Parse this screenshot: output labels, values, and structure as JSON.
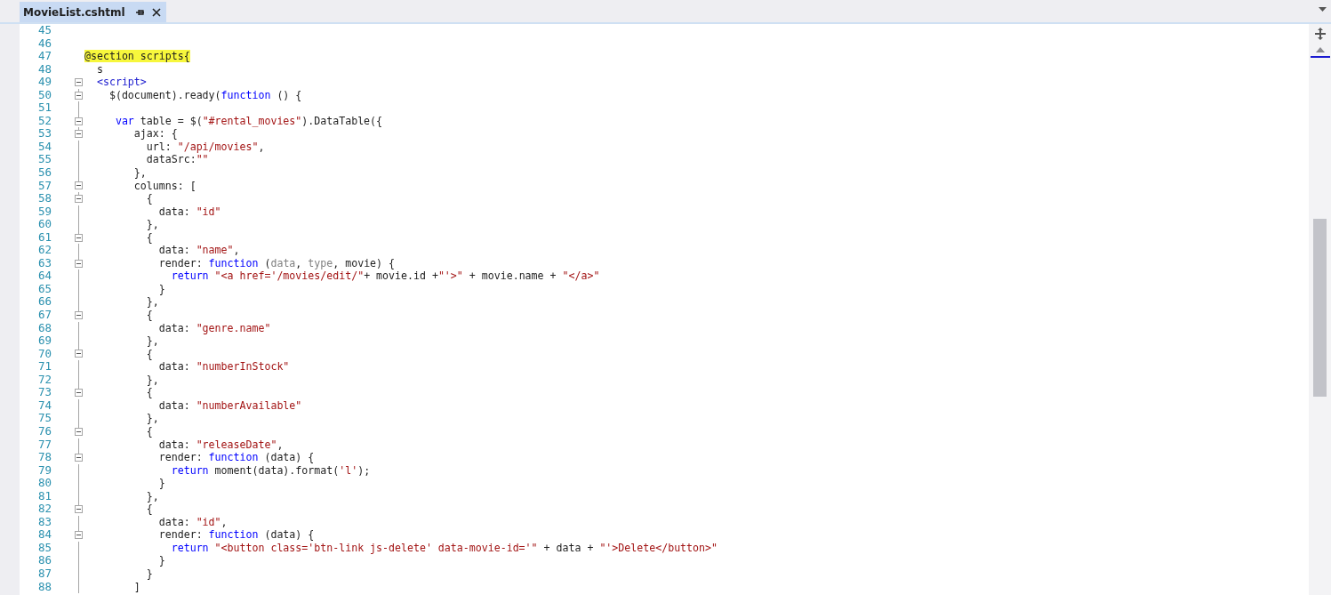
{
  "tab": {
    "title": "MovieList.cshtml",
    "selected": true
  },
  "editor": {
    "lines": [
      {
        "number": "45"
      },
      {
        "number": "46"
      },
      {
        "number": "47",
        "tokens": [
          {
            "kind": "highlight",
            "text": "@section scripts{"
          }
        ]
      },
      {
        "number": "48",
        "tokens": [
          {
            "kind": "plain",
            "text": "  s"
          }
        ]
      },
      {
        "number": "49",
        "expanded": true,
        "tokens": [
          {
            "kind": "tag",
            "text": "  <script>"
          }
        ]
      },
      {
        "number": "50",
        "expanded": true,
        "tokens": [
          {
            "kind": "plain",
            "text": "    $(document).ready("
          },
          {
            "kind": "keyword",
            "text": "function"
          },
          {
            "kind": "plain",
            "text": " () {"
          }
        ]
      },
      {
        "number": "51"
      },
      {
        "number": "52",
        "expanded": true,
        "tokens": [
          {
            "kind": "keyword",
            "text": "     var"
          },
          {
            "kind": "plain",
            "text": " table = $("
          },
          {
            "kind": "string",
            "text": "\"#rental_movies\""
          },
          {
            "kind": "plain",
            "text": ").DataTable({"
          }
        ]
      },
      {
        "number": "53",
        "expanded": true,
        "tokens": [
          {
            "kind": "plain",
            "text": "        ajax: {"
          }
        ]
      },
      {
        "number": "54",
        "tokens": [
          {
            "kind": "plain",
            "text": "          url: "
          },
          {
            "kind": "string",
            "text": "\"/api/movies\""
          },
          {
            "kind": "plain",
            "text": ","
          }
        ]
      },
      {
        "number": "55",
        "tokens": [
          {
            "kind": "plain",
            "text": "          dataSrc:"
          },
          {
            "kind": "string",
            "text": "\"\""
          }
        ]
      },
      {
        "number": "56",
        "tokens": [
          {
            "kind": "plain",
            "text": "        },"
          }
        ]
      },
      {
        "number": "57",
        "expanded": true,
        "tokens": [
          {
            "kind": "plain",
            "text": "        columns: ["
          }
        ]
      },
      {
        "number": "58",
        "expanded": true,
        "tokens": [
          {
            "kind": "plain",
            "text": "          {"
          }
        ]
      },
      {
        "number": "59",
        "tokens": [
          {
            "kind": "plain",
            "text": "            data: "
          },
          {
            "kind": "string",
            "text": "\"id\""
          }
        ]
      },
      {
        "number": "60",
        "tokens": [
          {
            "kind": "plain",
            "text": "          },"
          }
        ]
      },
      {
        "number": "61",
        "expanded": true,
        "tokens": [
          {
            "kind": "plain",
            "text": "          {"
          }
        ]
      },
      {
        "number": "62",
        "tokens": [
          {
            "kind": "plain",
            "text": "            data: "
          },
          {
            "kind": "string",
            "text": "\"name\""
          },
          {
            "kind": "plain",
            "text": ","
          }
        ]
      },
      {
        "number": "63",
        "expanded": true,
        "tokens": [
          {
            "kind": "plain",
            "text": "            render: "
          },
          {
            "kind": "keyword",
            "text": "function"
          },
          {
            "kind": "plain",
            "text": " ("
          },
          {
            "kind": "param",
            "text": "data"
          },
          {
            "kind": "plain",
            "text": ", "
          },
          {
            "kind": "param",
            "text": "type"
          },
          {
            "kind": "plain",
            "text": ", movie) {"
          }
        ]
      },
      {
        "number": "64",
        "tokens": [
          {
            "kind": "keyword",
            "text": "              return"
          },
          {
            "kind": "string",
            "text": " \"<a href='/movies/edit/\""
          },
          {
            "kind": "plain",
            "text": "+ movie.id +"
          },
          {
            "kind": "string",
            "text": "\"'>\""
          },
          {
            "kind": "plain",
            "text": " + movie.name + "
          },
          {
            "kind": "string",
            "text": "\"</a>\""
          }
        ]
      },
      {
        "number": "65",
        "tokens": [
          {
            "kind": "plain",
            "text": "            }"
          }
        ]
      },
      {
        "number": "66",
        "tokens": [
          {
            "kind": "plain",
            "text": "          },"
          }
        ]
      },
      {
        "number": "67",
        "expanded": true,
        "tokens": [
          {
            "kind": "plain",
            "text": "          {"
          }
        ]
      },
      {
        "number": "68",
        "tokens": [
          {
            "kind": "plain",
            "text": "            data: "
          },
          {
            "kind": "string",
            "text": "\"genre.name\""
          }
        ]
      },
      {
        "number": "69",
        "tokens": [
          {
            "kind": "plain",
            "text": "          },"
          }
        ]
      },
      {
        "number": "70",
        "expanded": true,
        "tokens": [
          {
            "kind": "plain",
            "text": "          {"
          }
        ]
      },
      {
        "number": "71",
        "tokens": [
          {
            "kind": "plain",
            "text": "            data: "
          },
          {
            "kind": "string",
            "text": "\"numberInStock\""
          }
        ]
      },
      {
        "number": "72",
        "tokens": [
          {
            "kind": "plain",
            "text": "          },"
          }
        ]
      },
      {
        "number": "73",
        "expanded": true,
        "tokens": [
          {
            "kind": "plain",
            "text": "          {"
          }
        ]
      },
      {
        "number": "74",
        "tokens": [
          {
            "kind": "plain",
            "text": "            data: "
          },
          {
            "kind": "string",
            "text": "\"numberAvailable\""
          }
        ]
      },
      {
        "number": "75",
        "tokens": [
          {
            "kind": "plain",
            "text": "          },"
          }
        ]
      },
      {
        "number": "76",
        "expanded": true,
        "tokens": [
          {
            "kind": "plain",
            "text": "          {"
          }
        ]
      },
      {
        "number": "77",
        "tokens": [
          {
            "kind": "plain",
            "text": "            data: "
          },
          {
            "kind": "string",
            "text": "\"releaseDate\""
          },
          {
            "kind": "plain",
            "text": ","
          }
        ]
      },
      {
        "number": "78",
        "expanded": true,
        "tokens": [
          {
            "kind": "plain",
            "text": "            render: "
          },
          {
            "kind": "keyword",
            "text": "function"
          },
          {
            "kind": "plain",
            "text": " (data) {"
          }
        ]
      },
      {
        "number": "79",
        "tokens": [
          {
            "kind": "keyword",
            "text": "              return"
          },
          {
            "kind": "plain",
            "text": " moment(data).format("
          },
          {
            "kind": "string",
            "text": "'l'"
          },
          {
            "kind": "plain",
            "text": ");"
          }
        ]
      },
      {
        "number": "80",
        "tokens": [
          {
            "kind": "plain",
            "text": "            }"
          }
        ]
      },
      {
        "number": "81",
        "tokens": [
          {
            "kind": "plain",
            "text": "          },"
          }
        ]
      },
      {
        "number": "82",
        "expanded": true,
        "tokens": [
          {
            "kind": "plain",
            "text": "          {"
          }
        ]
      },
      {
        "number": "83",
        "tokens": [
          {
            "kind": "plain",
            "text": "            data: "
          },
          {
            "kind": "string",
            "text": "\"id\""
          },
          {
            "kind": "plain",
            "text": ","
          }
        ]
      },
      {
        "number": "84",
        "expanded": true,
        "tokens": [
          {
            "kind": "plain",
            "text": "            render: "
          },
          {
            "kind": "keyword",
            "text": "function"
          },
          {
            "kind": "plain",
            "text": " (data) {"
          }
        ]
      },
      {
        "number": "85",
        "tokens": [
          {
            "kind": "keyword",
            "text": "              return"
          },
          {
            "kind": "string",
            "text": " \"<button class='btn-link js-delete' data-movie-id='\""
          },
          {
            "kind": "plain",
            "text": " + data + "
          },
          {
            "kind": "string",
            "text": "\"'>Delete</button>\""
          }
        ]
      },
      {
        "number": "86",
        "tokens": [
          {
            "kind": "plain",
            "text": "            }"
          }
        ]
      },
      {
        "number": "87",
        "tokens": [
          {
            "kind": "plain",
            "text": "          }"
          }
        ]
      },
      {
        "number": "88",
        "tokens": [
          {
            "kind": "plain",
            "text": "        ]"
          }
        ]
      }
    ]
  }
}
